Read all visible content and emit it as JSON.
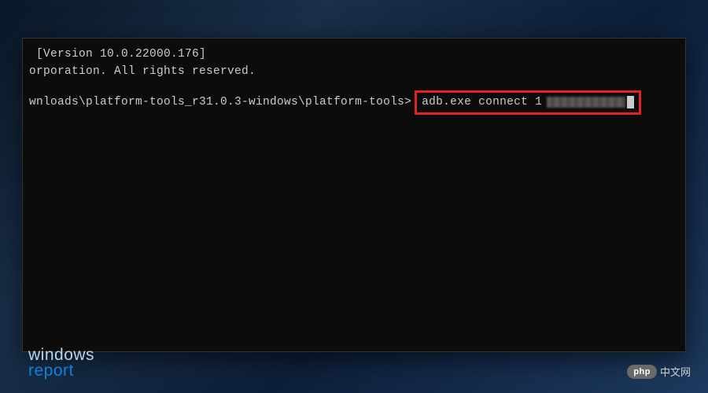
{
  "terminal": {
    "line1": " [Version 10.0.22000.176]",
    "line2": "orporation. All rights reserved.",
    "prompt_path": "wnloads\\platform-tools_r31.0.3-windows\\platform-tools>",
    "command": "adb.exe connect 1",
    "ip_redacted": true
  },
  "watermarks": {
    "left_line1": "windows",
    "left_line2": "report",
    "right_badge": "php",
    "right_text": "中文网"
  }
}
